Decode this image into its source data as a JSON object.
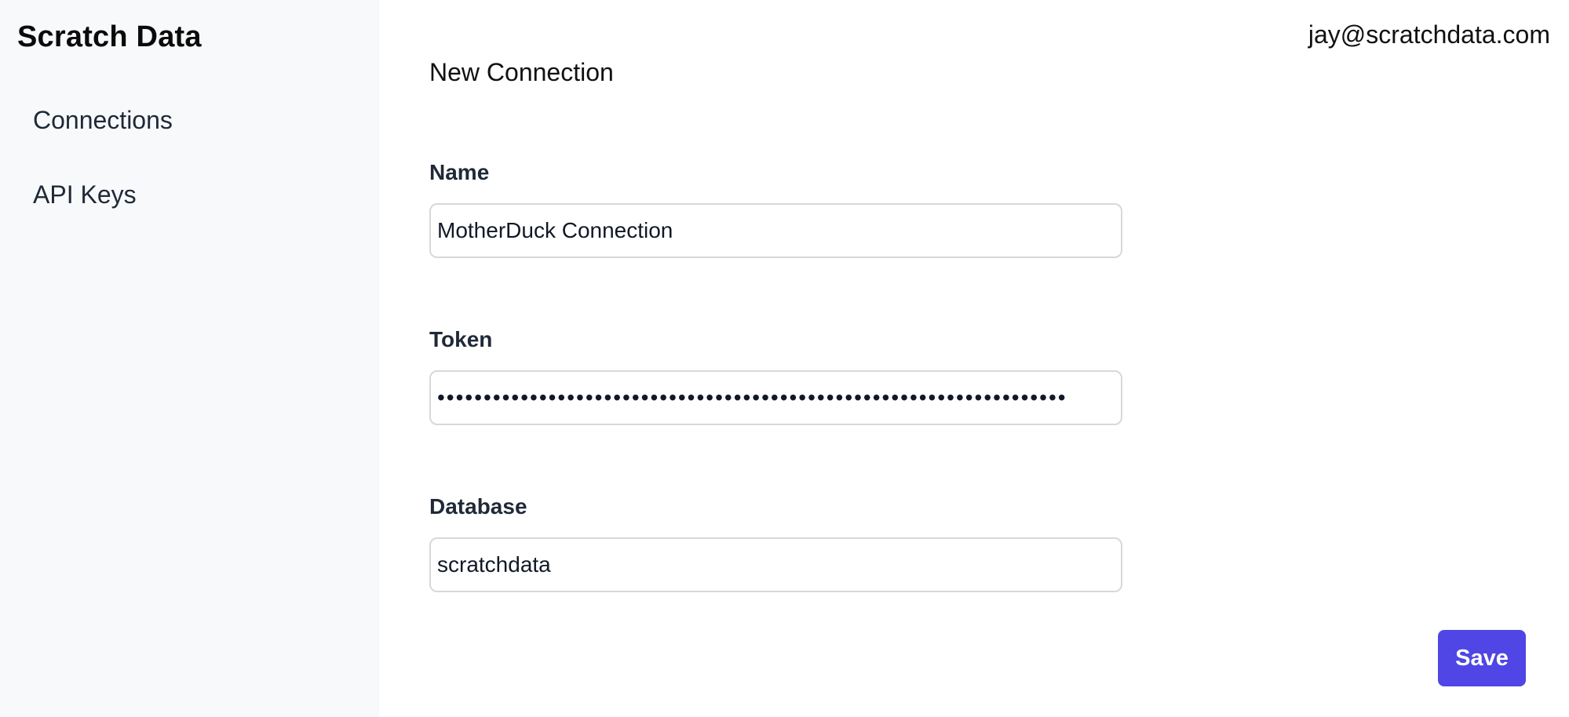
{
  "app": {
    "brand": "Scratch Data"
  },
  "sidebar": {
    "items": [
      {
        "label": "Connections"
      },
      {
        "label": "API Keys"
      }
    ]
  },
  "header": {
    "user_email": "jay@scratchdata.com"
  },
  "main": {
    "title": "New Connection",
    "form": {
      "name": {
        "label": "Name",
        "value": "MotherDuck Connection"
      },
      "token": {
        "label": "Token",
        "value": "••••••••••••••••••••••••••••••••••••••••••••••••••••••••••••••••••••"
      },
      "database": {
        "label": "Database",
        "value": "scratchdata"
      }
    },
    "save_label": "Save"
  },
  "colors": {
    "sidebar_bg": "#f8f9fb",
    "accent": "#4f46e5",
    "input_border": "#d6d8dc"
  }
}
